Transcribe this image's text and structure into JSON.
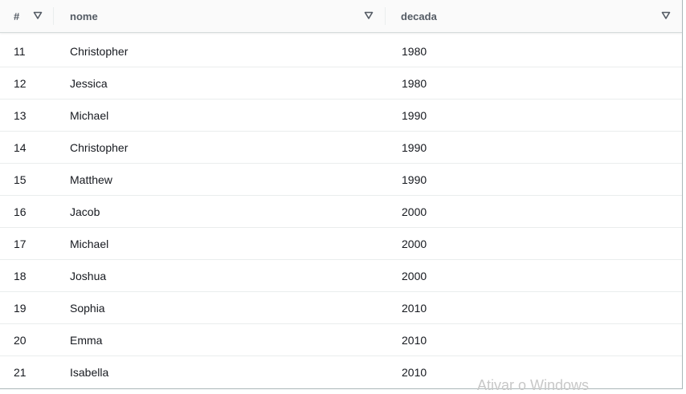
{
  "table": {
    "columns": [
      {
        "label": "#"
      },
      {
        "label": "nome"
      },
      {
        "label": "decada"
      }
    ],
    "sort_icon": "filter-triangle-icon",
    "rows": [
      {
        "num": "11",
        "nome": "Christopher",
        "decada": "1980"
      },
      {
        "num": "12",
        "nome": "Jessica",
        "decada": "1980"
      },
      {
        "num": "13",
        "nome": "Michael",
        "decada": "1990"
      },
      {
        "num": "14",
        "nome": "Christopher",
        "decada": "1990"
      },
      {
        "num": "15",
        "nome": "Matthew",
        "decada": "1990"
      },
      {
        "num": "16",
        "nome": "Jacob",
        "decada": "2000"
      },
      {
        "num": "17",
        "nome": "Michael",
        "decada": "2000"
      },
      {
        "num": "18",
        "nome": "Joshua",
        "decada": "2000"
      },
      {
        "num": "19",
        "nome": "Sophia",
        "decada": "2010"
      },
      {
        "num": "20",
        "nome": "Emma",
        "decada": "2010"
      },
      {
        "num": "21",
        "nome": "Isabella",
        "decada": "2010"
      }
    ]
  },
  "watermark": {
    "text": "Ativar o Windows"
  },
  "colors": {
    "header_bg": "#fafafa",
    "header_text": "#545b64",
    "cell_text": "#16191f",
    "row_divider": "#eaeded"
  }
}
